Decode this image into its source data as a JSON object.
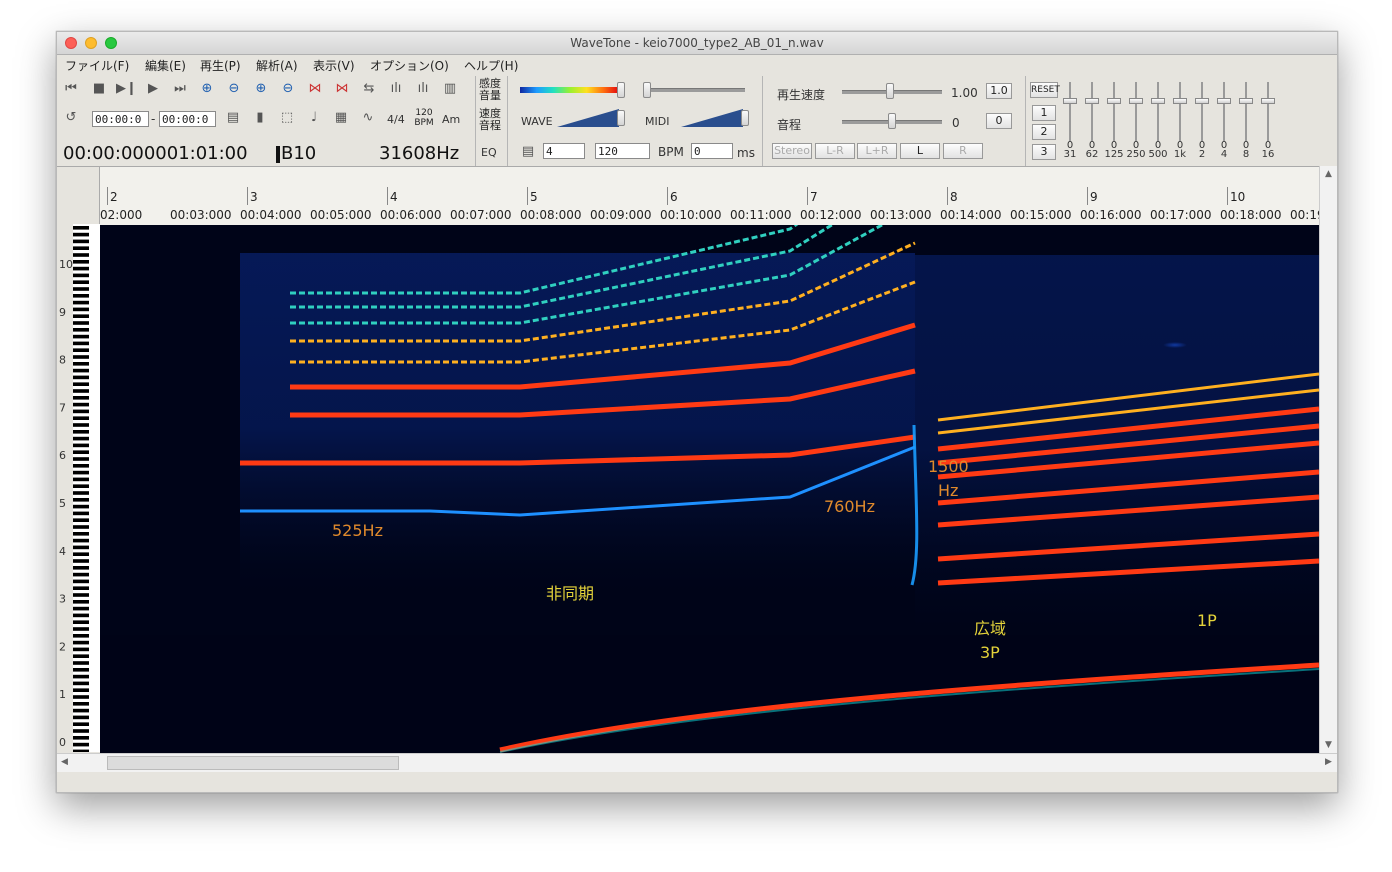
{
  "window": {
    "title": "WaveTone - keio7000_type2_AB_01_n.wav"
  },
  "menu": {
    "items": [
      "ファイル(F)",
      "編集(E)",
      "再生(P)",
      "解析(A)",
      "表示(V)",
      "オプション(O)",
      "ヘルプ(H)"
    ]
  },
  "toolbar": {
    "range_start": "00:00:0",
    "range_dash": "-",
    "range_end": "00:00:0",
    "time_sig": "4/4",
    "bpm_top": "120",
    "bpm_bottom": "BPM",
    "chord": "Am",
    "time_display": "00:00:000001:01:00",
    "note_display": "B10",
    "freq_display": "31608Hz",
    "eq_button": "EQ",
    "sensitivity_top": "感度",
    "sensitivity_bottom": "音量",
    "speed_top": "速度",
    "speed_bottom": "音程",
    "wave_label": "WAVE",
    "midi_label": "MIDI",
    "beats_value": "4",
    "tempo_value": "120",
    "bpm_label": "BPM",
    "ms_value": "0",
    "ms_label": "ms",
    "playback_speed_label": "再生速度",
    "playback_speed_value": "1.00",
    "playback_speed_reset": "1.0",
    "pitch_label": "音程",
    "pitch_value": "0",
    "pitch_reset": "0",
    "stereo": "Stereo",
    "l_minus_r": "L-R",
    "l_plus_r": "L+R",
    "left": "L",
    "right": "R",
    "eq_reset": "RESET",
    "eq_preset_1": "1",
    "eq_preset_2": "2",
    "eq_preset_3": "3",
    "eq_bands": [
      {
        "value": "0",
        "label": "31"
      },
      {
        "value": "0",
        "label": "62"
      },
      {
        "value": "0",
        "label": "125"
      },
      {
        "value": "0",
        "label": "250"
      },
      {
        "value": "0",
        "label": "500"
      },
      {
        "value": "0",
        "label": "1k"
      },
      {
        "value": "0",
        "label": "2"
      },
      {
        "value": "0",
        "label": "4"
      },
      {
        "value": "0",
        "label": "8"
      },
      {
        "value": "0",
        "label": "16"
      }
    ]
  },
  "ruler": {
    "measures": [
      "2",
      "3",
      "4",
      "5",
      "6",
      "7",
      "8",
      "9",
      "10"
    ],
    "times": [
      "02:000",
      "00:03:000",
      "00:04:000",
      "00:05:000",
      "00:06:000",
      "00:07:000",
      "00:08:000",
      "00:09:000",
      "00:10:000",
      "00:11:000",
      "00:12:000",
      "00:13:000",
      "00:14:000",
      "00:15:000",
      "00:16:000",
      "00:17:000",
      "00:18:000",
      "00:19:0"
    ]
  },
  "octaves": [
    "10",
    "9",
    "8",
    "7",
    "6",
    "5",
    "4",
    "3",
    "2",
    "1",
    "0"
  ],
  "annotations": {
    "a525": "525Hz",
    "async": "非同期",
    "a760": "760Hz",
    "a1500_top": "1500",
    "a1500_bottom": "Hz",
    "wide": "広域",
    "p3": "3P",
    "p1": "1P"
  },
  "colors": {
    "spectro_bg": "#000418",
    "harmonic": "#ff3a14",
    "orange_label": "#e08a2c",
    "yellow_label": "#e3d23a"
  }
}
